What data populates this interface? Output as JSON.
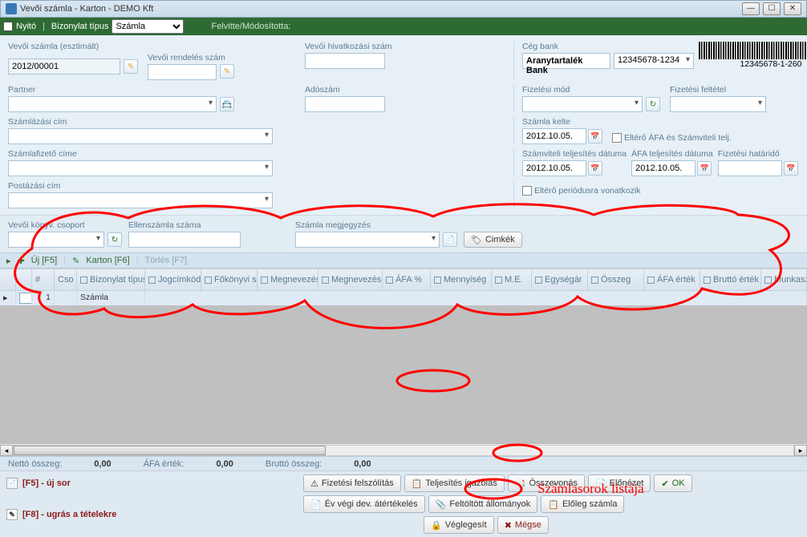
{
  "window_title": "Vevői számla - Karton - DEMO Kft",
  "toolbar": {
    "nyito": "Nyitó",
    "bizonylat_tipus_label": "Bizonylat típus",
    "bizonylat_tipus_value": "Számla",
    "felvitte": "Felvitte/Módosította:"
  },
  "form": {
    "vevoi_szamla_label": "Vevői számla (esztimált)",
    "vevoi_szamla_value": "2012/00001",
    "vevoi_rendeles_label": "Vevői rendelés szám",
    "vevoi_hivatkozas_label": "Vevői hivatkozási szám",
    "partner_label": "Partner",
    "adoszam_label": "Adószám",
    "szamlazasi_cim_label": "Számlázási cím",
    "szamlafizeto_label": "Számlafizető címe",
    "postazasi_label": "Postázási  cím",
    "ceg_bank_label": "Cég bank",
    "ceg_bank_value": "Aranytartalék Bank",
    "ceg_bank_acc": "12345678-1234",
    "barcode_text": "12345678-1-260",
    "fizetesi_mod_label": "Fizetési mód",
    "fizetesi_feltetel_label": "Fizetési feltétel",
    "szamla_kelte_label": "Számla kelte",
    "szamla_kelte_value": "2012.10.05.",
    "eltero_afa_label": "Eltérő ÁFA és Számviteli telj.",
    "szamviteli_label": "Számviteli teljesítés dátuma",
    "szamviteli_value": "2012.10.05.",
    "afa_telj_label": "ÁFA teljesítés dátuma",
    "afa_telj_value": "2012.10.05.",
    "fiz_hatarido_label": "Fizetési határidő",
    "eltero_periodus_label": "Eltérő periódusra vonatkozik"
  },
  "section2": {
    "vevoi_konyv_label": "Vevői könyv. csoport",
    "ellenszamla_label": "Ellenszámla száma",
    "szamla_megj_label": "Számla megjegyzés",
    "cimkek_label": "Cimkék"
  },
  "line_toolbar": {
    "uj": "Új  [F5]",
    "karton": "Karton  [F6]",
    "torles": "Törlés  [F7]"
  },
  "columns": [
    "#",
    "Cso",
    "Bizonylat típus",
    "Jogcímkód",
    "Főkönyvi számlaszám",
    "Megnevezés",
    "Megnevezés idegen nyelven",
    "ÁFA %",
    "Mennyiség",
    "M.E.",
    "Egységár",
    "Összeg",
    "ÁFA érték",
    "Bruttó érték",
    "Munkaszám"
  ],
  "row": {
    "num": "1",
    "btype": "Számla"
  },
  "summary": {
    "netto_label": "Nettó összeg:",
    "netto_value": "0,00",
    "afa_label": "ÁFA érték:",
    "afa_value": "0,00",
    "brutto_label": "Bruttó összeg:",
    "brutto_value": "0,00"
  },
  "footer": {
    "hint1": "[F5] - új sor",
    "hint2": "[F8] - ugrás a tételekre",
    "btns": {
      "fiz_felsz": "Fizetési felszólítás",
      "telj_ig": "Teljesítés igazolás",
      "osszevonas": "Összevonás",
      "elonezet": "Előnézet",
      "ok": "OK",
      "ev_vegi": "Év végi dev. átértékelés",
      "feltoltott": "Feltöltött állományok",
      "eloleg": "Előleg számla",
      "veglegesit": "Véglegesít",
      "megse": "Mégse"
    }
  },
  "annotation_label": "Számlasorok listája"
}
